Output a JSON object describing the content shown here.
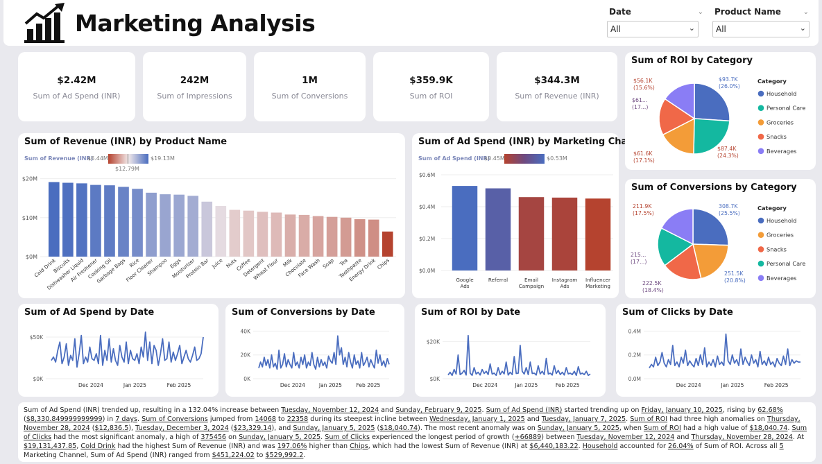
{
  "header": {
    "title": "Marketing Analysis",
    "slicers": [
      {
        "label": "Date",
        "value": "All"
      },
      {
        "label": "Product Name",
        "value": "All"
      }
    ]
  },
  "kpis": [
    {
      "value": "$2.42M",
      "label": "Sum of Ad Spend (INR)"
    },
    {
      "value": "242M",
      "label": "Sum of Impressions"
    },
    {
      "value": "1M",
      "label": "Sum of Conversions"
    },
    {
      "value": "$359.9K",
      "label": "Sum of ROI"
    },
    {
      "value": "$344.3M",
      "label": "Sum of Revenue (INR)"
    }
  ],
  "colors": {
    "blue": "#4a6dbf",
    "red": "#b5432f",
    "orange": "#f39c38",
    "teal": "#14b8a0",
    "coral": "#f06848",
    "lavender": "#8a7df5"
  },
  "revenue_chart": {
    "title": "Sum of Revenue (INR) by Product Name",
    "legend_label": "Sum of Revenue (INR)",
    "legend_min": "$6.44M",
    "legend_mid": "$12.79M",
    "legend_max": "$19.13M",
    "y_ticks": [
      "$20M",
      "$10M",
      "$0M"
    ]
  },
  "adspend_channel_chart": {
    "title": "Sum of Ad Spend (INR) by Marketing Channel",
    "legend_label": "Sum of Ad Spend (INR)",
    "legend_min": "$0.45M",
    "legend_max": "$0.53M",
    "y_ticks": [
      "$0.6M",
      "$0.4M",
      "$0.2M",
      "$0.0M"
    ]
  },
  "roi_category_chart": {
    "title": "Sum of ROI by Category",
    "legend_title": "Category",
    "slice_labels": [
      "$93.7K (26.0%)",
      "$87.4K (24.3%)",
      "$61.6K (17.1%)",
      "$61... (17...)",
      "$56.1K (15.6%)"
    ]
  },
  "conv_category_chart": {
    "title": "Sum of Conversions by Category",
    "legend_title": "Category",
    "slice_labels": [
      "308.7K (25.5%)",
      "251.5K (20.8%)",
      "222.5K (18.4%)",
      "215... (17...)",
      "211.9K (17.5%)"
    ]
  },
  "line_charts": [
    {
      "title": "Sum of Ad Spend by Date",
      "y_ticks": [
        "$50K",
        "$0K"
      ],
      "x_ticks": [
        "Dec 2024",
        "Jan 2025",
        "Feb 2025"
      ]
    },
    {
      "title": "Sum of Conversions by Date",
      "y_ticks": [
        "40K",
        "20K",
        "0K"
      ],
      "x_ticks": [
        "Dec 2024",
        "Jan 2025",
        "Feb 2025"
      ]
    },
    {
      "title": "Sum of ROI by Date",
      "y_ticks": [
        "$20K",
        "$0K"
      ],
      "x_ticks": [
        "Dec 2024",
        "Jan 2025",
        "Feb 2025"
      ]
    },
    {
      "title": "Sum of Clicks by Date",
      "y_ticks": [
        "0.4M",
        "0.2M",
        "0.0M"
      ],
      "x_ticks": [
        "Dec 2024",
        "Jan 2025",
        "Feb 2025"
      ]
    }
  ],
  "narrative": [
    {
      "t": "Sum of Ad Spend (INR) trended up, resulting in a 132.04% increase between "
    },
    {
      "t": "Tuesday, November 12, 2024",
      "u": true
    },
    {
      "t": " and "
    },
    {
      "t": "Sunday, February 9, 2025",
      "u": true
    },
    {
      "t": ". "
    },
    {
      "t": "Sum of Ad Spend (INR)",
      "u": true
    },
    {
      "t": " started trending up on "
    },
    {
      "t": "Friday, January 10, 2025",
      "u": true
    },
    {
      "t": ", rising by "
    },
    {
      "t": "62.68%",
      "u": true
    },
    {
      "t": " ("
    },
    {
      "t": "$8,330.849999999999",
      "u": true
    },
    {
      "t": ") in "
    },
    {
      "t": "7 days",
      "u": true
    },
    {
      "t": ". "
    },
    {
      "t": "Sum of Conversions",
      "u": true
    },
    {
      "t": " jumped from "
    },
    {
      "t": "14068",
      "u": true
    },
    {
      "t": " to "
    },
    {
      "t": "22358",
      "u": true
    },
    {
      "t": " during its steepest incline between "
    },
    {
      "t": "Wednesday, January 1, 2025",
      "u": true
    },
    {
      "t": " and "
    },
    {
      "t": "Tuesday, January 7, 2025",
      "u": true
    },
    {
      "t": ". "
    },
    {
      "t": "Sum of ROI",
      "u": true
    },
    {
      "t": " had three high anomalies on "
    },
    {
      "t": "Thursday, November 28, 2024",
      "u": true
    },
    {
      "t": " ("
    },
    {
      "t": "$12,836.5",
      "u": true
    },
    {
      "t": "), "
    },
    {
      "t": "Tuesday, December 3, 2024",
      "u": true
    },
    {
      "t": " ("
    },
    {
      "t": "$23,329.14",
      "u": true
    },
    {
      "t": "), and "
    },
    {
      "t": "Sunday, January 5, 2025",
      "u": true
    },
    {
      "t": " ("
    },
    {
      "t": "$18,040.74",
      "u": true
    },
    {
      "t": "). The most recent anomaly was on "
    },
    {
      "t": "Sunday, January 5, 2025",
      "u": true
    },
    {
      "t": ", when "
    },
    {
      "t": "Sum of ROI",
      "u": true
    },
    {
      "t": " had a high value of "
    },
    {
      "t": "$18,040.74",
      "u": true
    },
    {
      "t": ". "
    },
    {
      "t": "Sum of Clicks",
      "u": true
    },
    {
      "t": " had the most significant anomaly, a high of "
    },
    {
      "t": "375456",
      "u": true
    },
    {
      "t": " on "
    },
    {
      "t": "Sunday, January 5, 2025",
      "u": true
    },
    {
      "t": ". "
    },
    {
      "t": "Sum of Clicks",
      "u": true
    },
    {
      "t": " experienced the longest period of growth ("
    },
    {
      "t": "+66889",
      "u": true
    },
    {
      "t": ") between "
    },
    {
      "t": "Tuesday, November 12, 2024",
      "u": true
    },
    {
      "t": " and "
    },
    {
      "t": "Thursday, November 28, 2024",
      "u": true
    },
    {
      "t": ". At "
    },
    {
      "t": "$19,131,437.85",
      "u": true
    },
    {
      "t": ", "
    },
    {
      "t": "Cold Drink",
      "u": true
    },
    {
      "t": " had the highest Sum of Revenue (INR) and was "
    },
    {
      "t": "197.06%",
      "u": true
    },
    {
      "t": " higher than "
    },
    {
      "t": "Chips",
      "u": true
    },
    {
      "t": ", which had the lowest Sum of Revenue (INR) at "
    },
    {
      "t": "$6,440,183.22",
      "u": true
    },
    {
      "t": ". "
    },
    {
      "t": "Household",
      "u": true
    },
    {
      "t": " accounted for "
    },
    {
      "t": "26.04%",
      "u": true
    },
    {
      "t": " of Sum of ROI. Across all "
    },
    {
      "t": "5",
      "u": true
    },
    {
      "t": " Marketing Channel, Sum of Ad Spend (INR) ranged from "
    },
    {
      "t": "$451,224.02",
      "u": true
    },
    {
      "t": " to "
    },
    {
      "t": "$529,992.2",
      "u": true
    },
    {
      "t": "."
    }
  ],
  "chart_data": [
    {
      "type": "bar",
      "title": "Sum of Revenue (INR) by Product Name",
      "categories": [
        "Cold Drink",
        "Biscuits",
        "Dishwasher Liquid",
        "Air Freshener",
        "Cooking Oil",
        "Garbage Bags",
        "Rice",
        "Floor Cleaner",
        "Shampoo",
        "Eggs",
        "Moisturizer",
        "Protein Bar",
        "Juice",
        "Nuts",
        "Coffee",
        "Detergent",
        "Wheat Flour",
        "Milk",
        "Chocolate",
        "Face Wash",
        "Soap",
        "Tea",
        "Toothpaste",
        "Energy Drink",
        "Chips"
      ],
      "values": [
        19.13,
        18.95,
        18.8,
        18.4,
        18.3,
        17.9,
        17.4,
        16.4,
        16.0,
        15.9,
        15.6,
        14.1,
        13.0,
        12.0,
        11.8,
        11.5,
        11.3,
        10.8,
        10.7,
        10.4,
        10.2,
        10.0,
        9.6,
        9.5,
        6.44
      ],
      "ylabel": "",
      "ylim": [
        0,
        21
      ],
      "unit": "$M"
    },
    {
      "type": "bar",
      "title": "Sum of Ad Spend (INR) by Marketing Channel",
      "categories": [
        "Google Ads",
        "Referral",
        "Email Campaign",
        "Instagram Ads",
        "Influencer Marketing"
      ],
      "values": [
        0.53,
        0.515,
        0.46,
        0.457,
        0.451
      ],
      "ylim": [
        0,
        0.6
      ],
      "unit": "$M"
    },
    {
      "type": "pie",
      "title": "Sum of ROI by Category",
      "categories": [
        "Household",
        "Personal Care",
        "Groceries",
        "Snacks",
        "Beverages"
      ],
      "values": [
        93.7,
        87.4,
        61.6,
        61.1,
        56.1
      ],
      "colors": [
        "#4a6dbf",
        "#14b8a0",
        "#f39c38",
        "#f06848",
        "#8a7df5"
      ]
    },
    {
      "type": "pie",
      "title": "Sum of Conversions by Category",
      "categories": [
        "Household",
        "Groceries",
        "Snacks",
        "Personal Care",
        "Beverages"
      ],
      "values": [
        308.7,
        251.5,
        222.5,
        215.0,
        211.9
      ],
      "colors": [
        "#4a6dbf",
        "#f39c38",
        "#f06848",
        "#14b8a0",
        "#8a7df5"
      ]
    },
    {
      "type": "line",
      "title": "Sum of Ad Spend by Date",
      "ylim": [
        0,
        60000
      ],
      "values": [
        22000,
        26000,
        20000,
        34000,
        44000,
        18000,
        26000,
        42000,
        16000,
        28000,
        22000,
        48000,
        14000,
        30000,
        52000,
        18000,
        26000,
        20000,
        38000,
        24000,
        22000,
        30000,
        18000,
        52000,
        16000,
        34000,
        22000,
        48000,
        20000,
        36000,
        22000,
        16000,
        40000,
        26000,
        20000,
        44000,
        18000,
        34000,
        24000,
        22000,
        30000,
        18000,
        38000,
        26000,
        56000,
        22000,
        44000,
        18000,
        40000,
        34000,
        16000,
        30000,
        48000,
        22000,
        24000,
        44000,
        20000,
        32000,
        22000,
        30000,
        40000,
        18000,
        26000,
        34000,
        24000,
        20000,
        28000,
        38000,
        22000,
        24000,
        30000,
        50000
      ]
    },
    {
      "type": "line",
      "title": "Sum of Conversions by Date",
      "ylim": [
        0,
        42000
      ],
      "values": [
        9000,
        14000,
        10000,
        18000,
        11000,
        16000,
        9000,
        20000,
        10000,
        13000,
        8000,
        24000,
        9000,
        12000,
        21000,
        10000,
        16000,
        12000,
        9000,
        22000,
        11000,
        14000,
        9000,
        18000,
        12000,
        20000,
        9000,
        14000,
        11000,
        22000,
        12000,
        8000,
        18000,
        10000,
        16000,
        11000,
        14000,
        9000,
        19000,
        15000,
        13000,
        22000,
        12000,
        36000,
        20000,
        26000,
        12000,
        18000,
        10000,
        22000,
        14000,
        9000,
        20000,
        12000,
        15000,
        9000,
        22000,
        11000,
        14000,
        18000,
        10000,
        16000,
        12000,
        9000,
        24000,
        13000,
        20000,
        11000,
        15000,
        10000,
        17000,
        12000
      ]
    },
    {
      "type": "line",
      "title": "Sum of ROI by Date",
      "ylim": [
        0,
        27000
      ],
      "values": [
        2000,
        3500,
        1800,
        5000,
        2500,
        12836.5,
        2200,
        3000,
        4500,
        2000,
        23329.14,
        3000,
        1800,
        6000,
        2500,
        3500,
        2000,
        5000,
        2800,
        4000,
        2200,
        8000,
        2500,
        3000,
        1800,
        6000,
        2200,
        4000,
        2600,
        9000,
        2000,
        3500,
        2200,
        12000,
        2800,
        3000,
        18040.74,
        4000,
        2500,
        6000,
        2200,
        9000,
        2800,
        3000,
        2000,
        7000,
        2600,
        4000,
        2200,
        11000,
        2500,
        3000,
        2000,
        7000,
        2800,
        4500,
        2200,
        3500,
        2000,
        6000,
        2600,
        3000,
        2200,
        4000,
        1800,
        6500,
        2500,
        3000,
        2200,
        4000,
        1800,
        2500
      ]
    },
    {
      "type": "line",
      "title": "Sum of Clicks by Date",
      "ylim": [
        0,
        420000
      ],
      "values": [
        90000,
        120000,
        100000,
        180000,
        110000,
        140000,
        220000,
        130000,
        100000,
        160000,
        120000,
        280000,
        110000,
        140000,
        100000,
        180000,
        130000,
        240000,
        110000,
        150000,
        120000,
        100000,
        170000,
        110000,
        200000,
        120000,
        260000,
        100000,
        140000,
        110000,
        160000,
        100000,
        190000,
        120000,
        140000,
        110000,
        375456,
        150000,
        120000,
        200000,
        130000,
        160000,
        110000,
        250000,
        120000,
        180000,
        140000,
        110000,
        200000,
        130000,
        160000,
        100000,
        230000,
        120000,
        150000,
        110000,
        180000,
        120000,
        140000,
        100000,
        170000,
        130000,
        110000,
        190000,
        120000,
        250000,
        110000,
        160000,
        130000,
        150000,
        140000,
        140000
      ]
    }
  ]
}
